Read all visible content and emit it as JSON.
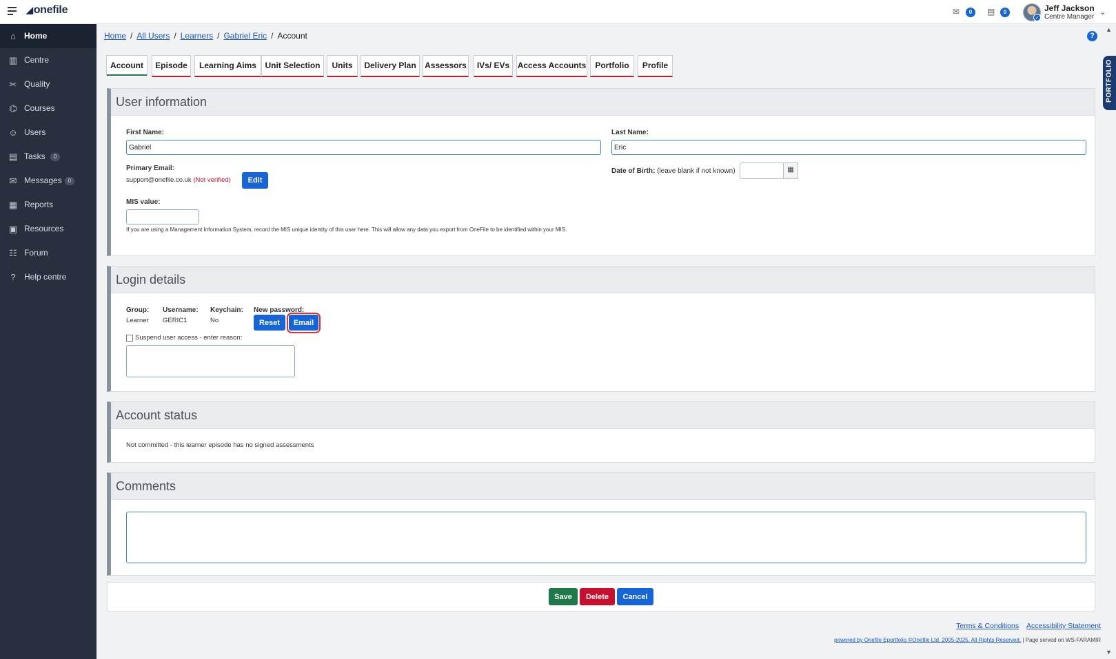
{
  "app": {
    "logo": "onefile"
  },
  "topbar": {
    "messages_count": "0",
    "tasks_count": "0",
    "user_name": "Jeff Jackson",
    "user_role": "Centre Manager"
  },
  "sidebar": {
    "items": [
      {
        "label": "Home",
        "icon": "home-icon"
      },
      {
        "label": "Centre",
        "icon": "building-icon"
      },
      {
        "label": "Quality",
        "icon": "tools-icon"
      },
      {
        "label": "Courses",
        "icon": "graduation-cap-icon"
      },
      {
        "label": "Users",
        "icon": "users-icon"
      },
      {
        "label": "Tasks",
        "icon": "clipboard-icon",
        "count": "0"
      },
      {
        "label": "Messages",
        "icon": "envelope-icon",
        "count": "0"
      },
      {
        "label": "Reports",
        "icon": "report-icon"
      },
      {
        "label": "Resources",
        "icon": "resources-icon"
      },
      {
        "label": "Forum",
        "icon": "forum-icon"
      },
      {
        "label": "Help centre",
        "icon": "question-circle-icon"
      }
    ]
  },
  "breadcrumb": {
    "home": "Home",
    "all_users": "All Users",
    "learners": "Learners",
    "learner": "Gabriel Eric",
    "current": "Account",
    "separator": "/"
  },
  "tabs": [
    "Account",
    "Episode",
    "Learning Aims",
    "Unit Selection",
    "Units",
    "Delivery Plan",
    "Assessors",
    "IVs/ EVs",
    "Access Accounts",
    "Portfolio",
    "Profile"
  ],
  "portfolio_side_tab": "PORTFOLIO",
  "user_information": {
    "title": "User information",
    "first_name_label": "First Name:",
    "first_name": "Gabriel",
    "last_name_label": "Last Name:",
    "last_name": "Eric",
    "primary_email_label": "Primary Email:",
    "primary_email": "support@onefile.co.uk",
    "email_status": "(Not verified)",
    "edit_label": "Edit",
    "dob_label": "Date of Birth:",
    "dob_hint": "(leave blank if not known)",
    "dob_value": "",
    "mis_label": "MIS value:",
    "mis_value": "",
    "mis_help": "If you are using a Management Information System, record the MIS unique identity of this user here. This will allow any data you export from OneFile to be identified within your MIS."
  },
  "login_details": {
    "title": "Login details",
    "group_label": "Group:",
    "group_value": "Learner",
    "username_label": "Username:",
    "username_value": "GERIC1",
    "keychain_label": "Keychain:",
    "keychain_value": "No",
    "new_password_label": "New password:",
    "reset_label": "Reset",
    "email_label": "Email",
    "suspend_label": "Suspend user access - enter reason:",
    "suspend_reason": ""
  },
  "account_status": {
    "title": "Account status",
    "text": "Not committed - this learner episode has no signed assessments"
  },
  "comments": {
    "title": "Comments",
    "value": ""
  },
  "actions": {
    "save": "Save",
    "delete": "Delete",
    "cancel": "Cancel"
  },
  "footer": {
    "terms": "Terms & Conditions",
    "accessibility": "Accessibility Statement",
    "powered_by": "powered by Onefile Eportfolio ©Onefile Ltd. 2005-2025. All Rights Reserved.",
    "served": "| Page served on WS-FARAMIR"
  },
  "colors": {
    "sidebar_bg": "#27303f",
    "primary_blue": "#1565d8",
    "save_green": "#1f7a4a",
    "delete_red": "#c8102e",
    "tab_underline": "#b8212c",
    "highlight_red": "#e03232"
  }
}
